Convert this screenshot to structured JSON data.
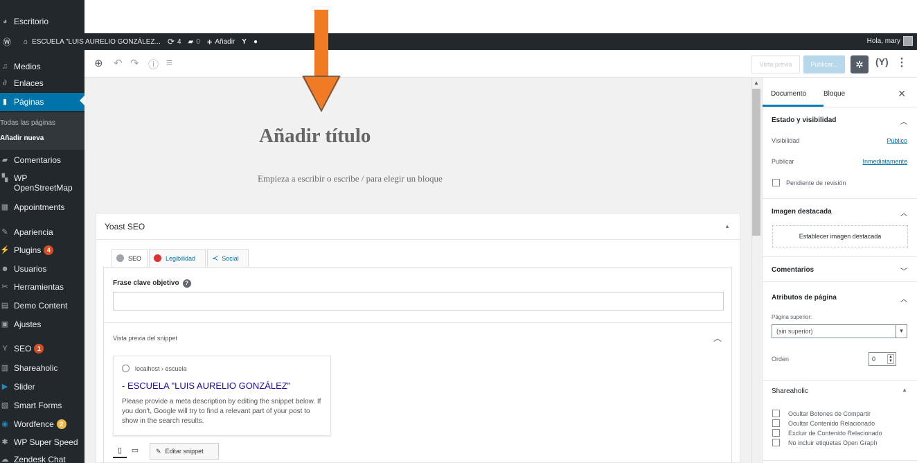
{
  "sidebar": {
    "items": [
      {
        "label": "Escritorio",
        "icon": "dashboard-icon"
      },
      {
        "label": "Medios",
        "icon": "media-icon"
      },
      {
        "label": "Enlaces",
        "icon": "links-icon"
      },
      {
        "label": "Páginas",
        "icon": "pages-icon"
      },
      {
        "label": "Comentarios",
        "icon": "comments-icon"
      },
      {
        "label": "WP OpenStreetMap",
        "icon": "map-icon"
      },
      {
        "label": "Appointments",
        "icon": "calendar-icon"
      },
      {
        "label": "Apariencia",
        "icon": "appearance-icon"
      },
      {
        "label": "Plugins",
        "icon": "plugins-icon",
        "badge": "4"
      },
      {
        "label": "Usuarios",
        "icon": "users-icon"
      },
      {
        "label": "Herramientas",
        "icon": "tools-icon"
      },
      {
        "label": "Demo Content",
        "icon": "demo-icon"
      },
      {
        "label": "Ajustes",
        "icon": "settings-icon"
      },
      {
        "label": "SEO",
        "icon": "yoast-icon",
        "badge": "1"
      },
      {
        "label": "Shareaholic",
        "icon": "share-icon"
      },
      {
        "label": "Slider",
        "icon": "slider-icon"
      },
      {
        "label": "Smart Forms",
        "icon": "forms-icon"
      },
      {
        "label": "Wordfence",
        "icon": "wordfence-icon",
        "badge": "2"
      },
      {
        "label": "WP Super Speed",
        "icon": "speed-icon"
      },
      {
        "label": "Zendesk Chat",
        "icon": "chat-icon"
      }
    ],
    "submenu": {
      "all_pages": "Todas las páginas",
      "add_new": "Añadir nueva"
    }
  },
  "adminbar": {
    "site_name": "ESCUELA \"LUIS AURELIO GONZÁLEZ...",
    "updates_count": "4",
    "comments_count": "0",
    "add_new": "Añadir",
    "greeting": "Hola, mary"
  },
  "toolbar": {
    "preview_label": "Vista previa",
    "publish_label": "Publicar..."
  },
  "editor": {
    "title_placeholder": "Añadir título",
    "block_placeholder": "Empieza a escribir o escribe / para elegir un bloque"
  },
  "yoast": {
    "title": "Yoast SEO",
    "tabs": [
      "SEO",
      "Legibilidad",
      "Social"
    ],
    "keyphrase_label": "Frase clave objetivo",
    "snippet_label": "Vista previa del snippet",
    "snippet_url": "localhost › escuela",
    "snippet_title": "- ESCUELA \"LUIS AURELIO GONZÁLEZ\"",
    "snippet_desc": "Please provide a meta description by editing the snippet below. If you don't, Google will try to find a relevant part of your post to show in the search results.",
    "edit_snippet": "Editar snippet"
  },
  "settings": {
    "tab_document": "Documento",
    "tab_block": "Bloque",
    "status_title": "Estado y visibilidad",
    "visibility_label": "Visibilidad",
    "visibility_value": "Público",
    "publish_label": "Publicar",
    "publish_value": "Inmediatamente",
    "pending_review": "Pendiente de revisión",
    "featured_title": "Imagen destacada",
    "featured_button": "Establecer imagen destacada",
    "comments_title": "Comentarios",
    "attributes_title": "Atributos de página",
    "parent_label": "Página superior:",
    "parent_value": "(sin superior)",
    "order_label": "Orden",
    "order_value": "0",
    "shareaholic_title": "Shareaholic",
    "share_options": [
      "Ocultar Botones de Compartir",
      "Ocultar Contenido Relacionado",
      "Excluir de Contenido Relacionado",
      "No incluir etiquetas Open Graph"
    ]
  },
  "colors": {
    "admin_dark": "#23282d",
    "admin_blue": "#0073aa",
    "arrow_orange": "#f07b24",
    "badge_red": "#d54e21"
  }
}
